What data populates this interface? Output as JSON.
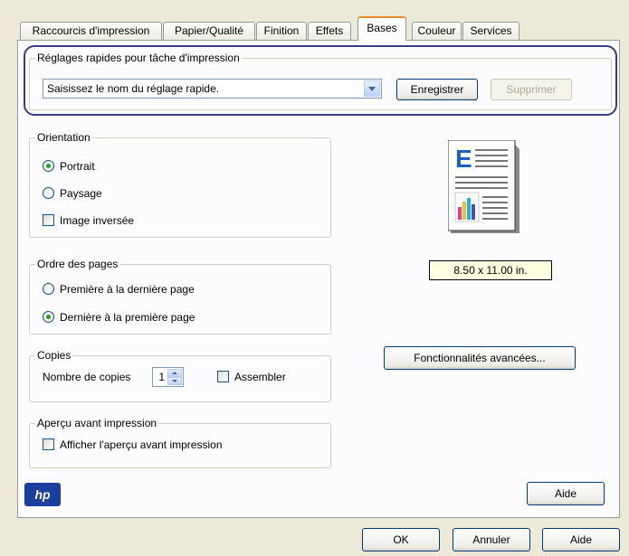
{
  "tabs": [
    {
      "label": "Raccourcis d'impression",
      "active": false
    },
    {
      "label": "Papier/Qualité",
      "active": false
    },
    {
      "label": "Finition",
      "active": false
    },
    {
      "label": "Effets",
      "active": false
    },
    {
      "label": "Bases",
      "active": true
    },
    {
      "label": "Couleur",
      "active": false
    },
    {
      "label": "Services",
      "active": false
    }
  ],
  "quick_settings": {
    "legend": "Réglages rapides pour tâche d'impression",
    "combo_value": "Saisissez le nom du réglage rapide.",
    "save_label": "Enregistrer",
    "delete_label": "Supprimer"
  },
  "orientation": {
    "legend": "Orientation",
    "portrait": "Portrait",
    "landscape": "Paysage",
    "mirror": "Image inversée",
    "selected": "portrait"
  },
  "page_order": {
    "legend": "Ordre des pages",
    "first_to_last": "Première à la dernière page",
    "last_to_first": "Dernière à la première page",
    "selected": "last_to_first"
  },
  "copies": {
    "legend": "Copies",
    "count_label": "Nombre de copies",
    "count": "1",
    "collate_label": "Assembler"
  },
  "preview": {
    "legend": "Aperçu avant impression",
    "show_label": "Afficher l'aperçu avant impression"
  },
  "paper_size": "8.50 x 11.00 in.",
  "advanced_label": "Fonctionnalités avancées...",
  "help_label": "Aide",
  "logo_text": "hp",
  "footer": {
    "ok": "OK",
    "cancel": "Annuler",
    "help": "Aide"
  },
  "colors": {
    "accent_tab": "#e68b2c",
    "highlight": "#3a3a86",
    "paper_bg": "#ffffe1",
    "hp_blue": "#1a3f9e"
  }
}
